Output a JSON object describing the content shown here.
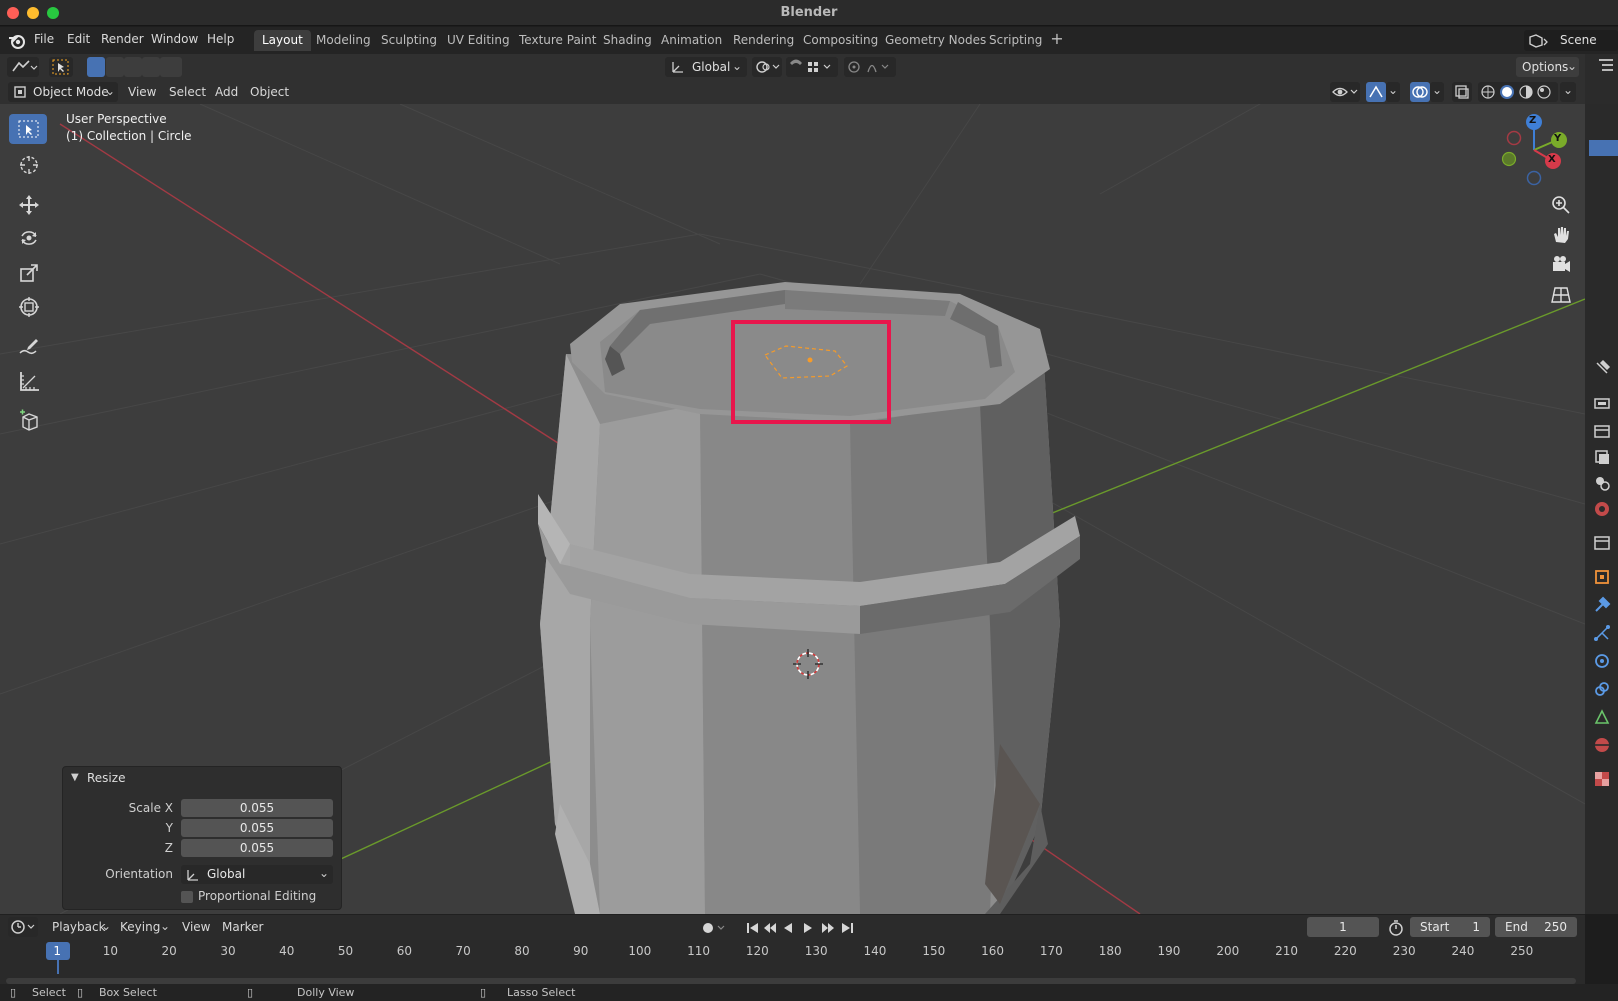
{
  "window": {
    "title": "Blender"
  },
  "menus": [
    "File",
    "Edit",
    "Render",
    "Window",
    "Help"
  ],
  "workspaces": [
    "Layout",
    "Modeling",
    "Sculpting",
    "UV Editing",
    "Texture Paint",
    "Shading",
    "Animation",
    "Rendering",
    "Compositing",
    "Geometry Nodes",
    "Scripting"
  ],
  "scene": {
    "label": "Scene"
  },
  "toolbar": {
    "orientation": "Global",
    "options": "Options"
  },
  "viewport_header": {
    "mode": "Object Mode",
    "menus": [
      "View",
      "Select",
      "Add",
      "Object"
    ]
  },
  "viewport": {
    "perspective": "User Perspective",
    "collection": "(1) Collection | Circle",
    "gizmo": {
      "x": "X",
      "y": "Y",
      "z": "Z"
    },
    "colors": {
      "x_axis": "#a23a44",
      "y_axis": "#6a9a2b",
      "highlight": "#e8164c",
      "selection": "#f59b2a"
    }
  },
  "operator_panel": {
    "title": "Resize",
    "scale_x_label": "Scale X",
    "scale_y_label": "Y",
    "scale_z_label": "Z",
    "scale_x": "0.055",
    "scale_y": "0.055",
    "scale_z": "0.055",
    "orientation_label": "Orientation",
    "orientation_value": "Global",
    "proportional_label": "Proportional Editing",
    "proportional_checked": false
  },
  "timeline": {
    "menus": [
      "Playback",
      "Keying",
      "View",
      "Marker"
    ],
    "current_frame": "1",
    "start_label": "Start",
    "start": "1",
    "end_label": "End",
    "end": "250",
    "ticks": [
      "1",
      "10",
      "20",
      "30",
      "40",
      "50",
      "60",
      "70",
      "80",
      "90",
      "100",
      "110",
      "120",
      "130",
      "140",
      "150",
      "160",
      "170",
      "180",
      "190",
      "200",
      "210",
      "220",
      "230",
      "240",
      "250"
    ]
  },
  "statusbar": {
    "select": "Select",
    "box_select": "Box Select",
    "dolly_view": "Dolly View",
    "lasso_select": "Lasso Select"
  }
}
